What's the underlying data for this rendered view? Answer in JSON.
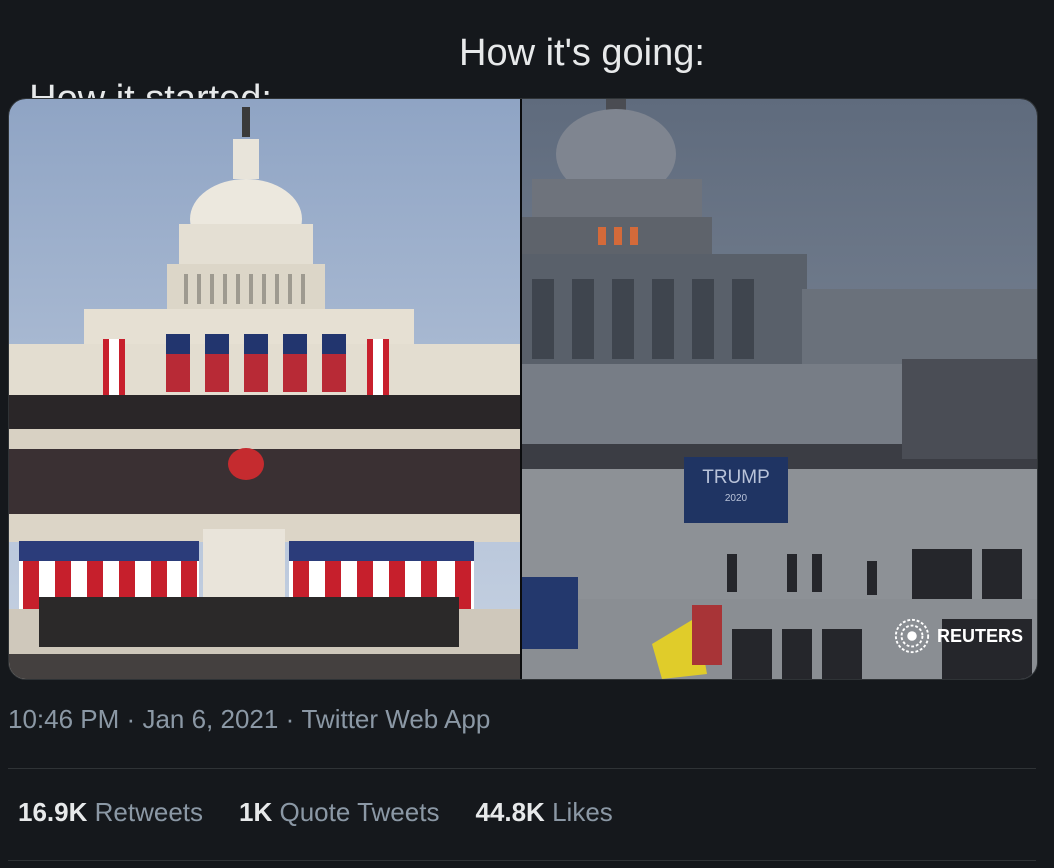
{
  "tweet": {
    "text_left": "How it started:",
    "text_right": "How it's going:"
  },
  "media": {
    "left_photo": "capitol-inauguration-photo",
    "right_photo": "capitol-riot-photo",
    "banner_text": "TRUMP",
    "banner_year": "2020",
    "credit": "REUTERS"
  },
  "meta": {
    "time": "10:46 PM",
    "date": "Jan 6, 2021",
    "source": "Twitter Web App",
    "sep": "·"
  },
  "stats": [
    {
      "num": "16.9K",
      "label": "Retweets"
    },
    {
      "num": "1K",
      "label": "Quote Tweets"
    },
    {
      "num": "44.8K",
      "label": "Likes"
    }
  ]
}
